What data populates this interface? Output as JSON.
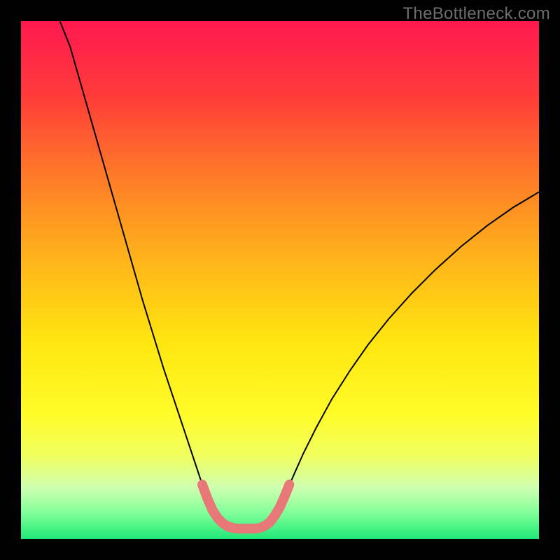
{
  "watermark": "TheBottleneck.com",
  "chart_data": {
    "type": "line",
    "title": "",
    "xlabel": "",
    "ylabel": "",
    "xlim": [
      0,
      1
    ],
    "ylim": [
      0,
      1
    ],
    "gradient_stops": [
      {
        "offset": 0.0,
        "color": "#ff1850"
      },
      {
        "offset": 0.14,
        "color": "#ff3a3a"
      },
      {
        "offset": 0.3,
        "color": "#ff7a28"
      },
      {
        "offset": 0.46,
        "color": "#ffb41a"
      },
      {
        "offset": 0.62,
        "color": "#ffe610"
      },
      {
        "offset": 0.76,
        "color": "#fffc28"
      },
      {
        "offset": 0.84,
        "color": "#f0ff60"
      },
      {
        "offset": 0.9,
        "color": "#d0ffb0"
      },
      {
        "offset": 0.95,
        "color": "#80ff98"
      },
      {
        "offset": 1.0,
        "color": "#20e878"
      }
    ],
    "series": [
      {
        "name": "curve",
        "stroke": "#000000",
        "stroke_width": 2,
        "points": [
          {
            "x": 0.075,
            "y": 1.0
          },
          {
            "x": 0.095,
            "y": 0.95
          },
          {
            "x": 0.115,
            "y": 0.88
          },
          {
            "x": 0.135,
            "y": 0.81
          },
          {
            "x": 0.155,
            "y": 0.74
          },
          {
            "x": 0.175,
            "y": 0.67
          },
          {
            "x": 0.195,
            "y": 0.6
          },
          {
            "x": 0.215,
            "y": 0.53
          },
          {
            "x": 0.235,
            "y": 0.46
          },
          {
            "x": 0.255,
            "y": 0.395
          },
          {
            "x": 0.275,
            "y": 0.33
          },
          {
            "x": 0.295,
            "y": 0.27
          },
          {
            "x": 0.315,
            "y": 0.21
          },
          {
            "x": 0.335,
            "y": 0.15
          },
          {
            "x": 0.35,
            "y": 0.105
          },
          {
            "x": 0.36,
            "y": 0.078
          },
          {
            "x": 0.37,
            "y": 0.055
          },
          {
            "x": 0.38,
            "y": 0.038
          },
          {
            "x": 0.39,
            "y": 0.028
          },
          {
            "x": 0.4,
            "y": 0.022
          },
          {
            "x": 0.41,
            "y": 0.02
          },
          {
            "x": 0.42,
            "y": 0.02
          },
          {
            "x": 0.43,
            "y": 0.02
          },
          {
            "x": 0.44,
            "y": 0.02
          },
          {
            "x": 0.45,
            "y": 0.02
          },
          {
            "x": 0.46,
            "y": 0.02
          },
          {
            "x": 0.47,
            "y": 0.023
          },
          {
            "x": 0.48,
            "y": 0.03
          },
          {
            "x": 0.49,
            "y": 0.042
          },
          {
            "x": 0.5,
            "y": 0.06
          },
          {
            "x": 0.51,
            "y": 0.085
          },
          {
            "x": 0.525,
            "y": 0.12
          },
          {
            "x": 0.545,
            "y": 0.165
          },
          {
            "x": 0.57,
            "y": 0.215
          },
          {
            "x": 0.6,
            "y": 0.27
          },
          {
            "x": 0.635,
            "y": 0.325
          },
          {
            "x": 0.67,
            "y": 0.375
          },
          {
            "x": 0.71,
            "y": 0.425
          },
          {
            "x": 0.755,
            "y": 0.475
          },
          {
            "x": 0.8,
            "y": 0.52
          },
          {
            "x": 0.85,
            "y": 0.565
          },
          {
            "x": 0.9,
            "y": 0.605
          },
          {
            "x": 0.95,
            "y": 0.64
          },
          {
            "x": 1.0,
            "y": 0.67
          }
        ]
      },
      {
        "name": "marker-overlay",
        "stroke": "#e87878",
        "stroke_width": 14,
        "stroke_linecap": "round",
        "points": [
          {
            "x": 0.35,
            "y": 0.105
          },
          {
            "x": 0.36,
            "y": 0.078
          },
          {
            "x": 0.37,
            "y": 0.055
          },
          {
            "x": 0.38,
            "y": 0.04
          },
          {
            "x": 0.39,
            "y": 0.03
          },
          {
            "x": 0.4,
            "y": 0.024
          },
          {
            "x": 0.41,
            "y": 0.021
          },
          {
            "x": 0.42,
            "y": 0.02
          },
          {
            "x": 0.43,
            "y": 0.02
          },
          {
            "x": 0.44,
            "y": 0.02
          },
          {
            "x": 0.45,
            "y": 0.02
          },
          {
            "x": 0.46,
            "y": 0.021
          },
          {
            "x": 0.47,
            "y": 0.025
          },
          {
            "x": 0.48,
            "y": 0.032
          },
          {
            "x": 0.49,
            "y": 0.045
          },
          {
            "x": 0.5,
            "y": 0.062
          },
          {
            "x": 0.51,
            "y": 0.085
          },
          {
            "x": 0.518,
            "y": 0.105
          }
        ]
      }
    ]
  }
}
